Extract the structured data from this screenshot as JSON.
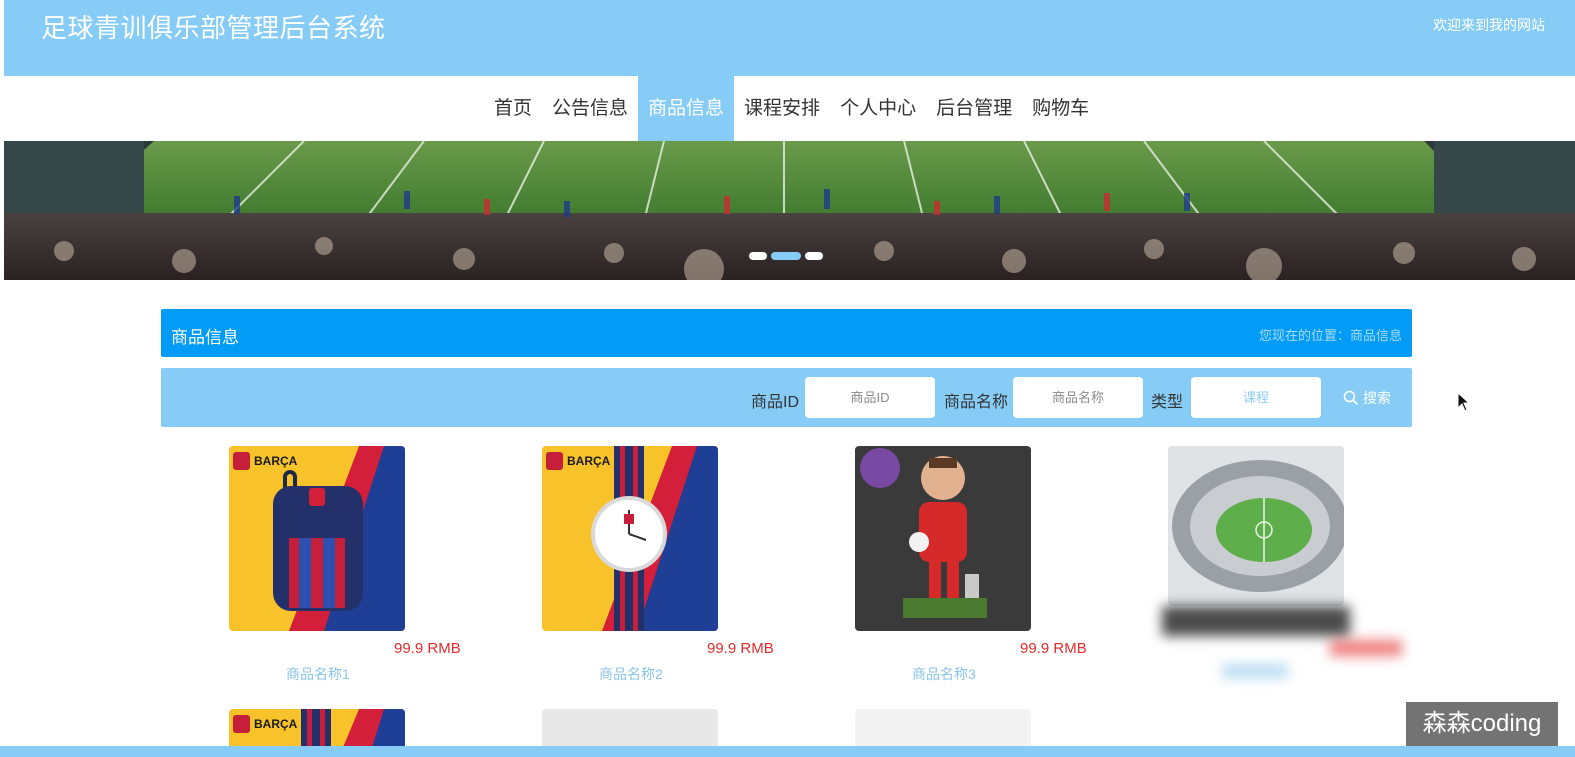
{
  "header": {
    "title": "足球青训俱乐部管理后台系统",
    "welcome": "欢迎来到我的网站"
  },
  "nav": {
    "items": [
      "首页",
      "公告信息",
      "商品信息",
      "课程安排",
      "个人中心",
      "后台管理",
      "购物车"
    ],
    "active": "商品信息"
  },
  "banner": {
    "slide_count": 3,
    "active_slide": 2
  },
  "section": {
    "title": "商品信息",
    "breadcrumb": "您现在的位置：商品信息"
  },
  "search": {
    "id_label": "商品ID",
    "id_placeholder": "商品ID",
    "name_label": "商品名称",
    "name_placeholder": "商品名称",
    "type_label": "类型",
    "type_value": "课程",
    "button_label": "搜索"
  },
  "products": [
    {
      "image": "backpack-image",
      "price": "99.9 RMB",
      "name": "商品名称1",
      "brand": "BARÇA"
    },
    {
      "image": "watch-image",
      "price": "99.9 RMB",
      "name": "商品名称2",
      "brand": "BARÇA"
    },
    {
      "image": "figurine-image",
      "price": "99.9 RMB",
      "name": "商品名称3",
      "brand": ""
    },
    {
      "image": "stadium-image",
      "price": "",
      "name": "",
      "brand": ""
    }
  ],
  "second_row_brand": "BARÇA",
  "watermark": "森森coding",
  "colors": {
    "header_bg": "#87ccf7",
    "section_bar": "#029bf5",
    "price": "#e52b2b",
    "product_name": "#8ac4e8"
  }
}
